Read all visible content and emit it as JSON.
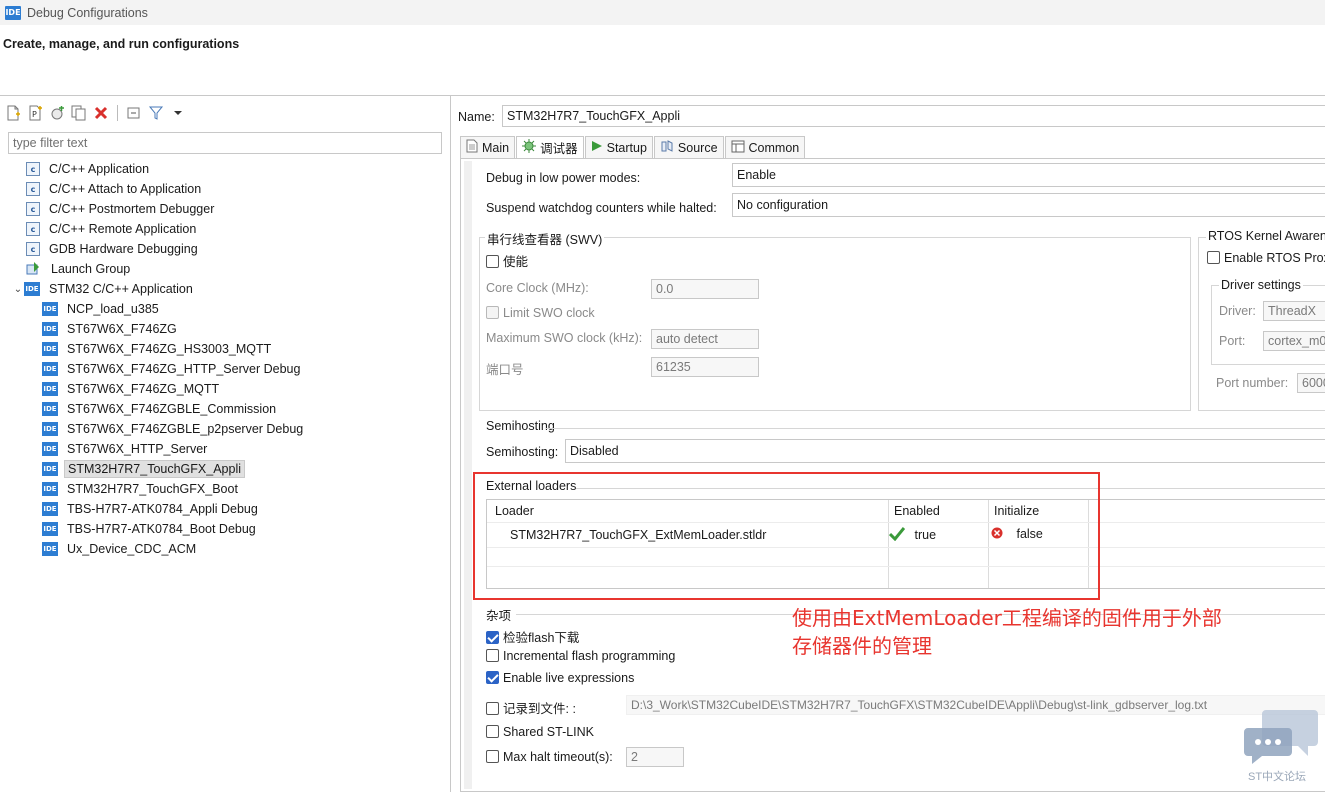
{
  "window": {
    "app_badge": "IDE",
    "title": "Debug Configurations"
  },
  "header": {
    "subtitle": "Create, manage, and run configurations"
  },
  "left": {
    "toolbar": [
      "new-config-icon",
      "new-prototype-icon",
      "export-icon",
      "duplicate-icon",
      "delete-icon",
      "collapse-all-icon",
      "filter-icon",
      "menu-chevron-icon"
    ],
    "filter_placeholder": "type filter text",
    "tree": [
      {
        "label": "C/C++ Application",
        "icon": "c"
      },
      {
        "label": "C/C++ Attach to Application",
        "icon": "c"
      },
      {
        "label": "C/C++ Postmortem Debugger",
        "icon": "c"
      },
      {
        "label": "C/C++ Remote Application",
        "icon": "c"
      },
      {
        "label": "GDB Hardware Debugging",
        "icon": "c"
      },
      {
        "label": "Launch Group",
        "icon": "launch"
      },
      {
        "label": "STM32 C/C++ Application",
        "icon": "ide",
        "expanded": true
      },
      {
        "label": "NCP_load_u385",
        "icon": "ide"
      },
      {
        "label": "ST67W6X_F746ZG",
        "icon": "ide"
      },
      {
        "label": "ST67W6X_F746ZG_HS3003_MQTT",
        "icon": "ide"
      },
      {
        "label": "ST67W6X_F746ZG_HTTP_Server Debug",
        "icon": "ide"
      },
      {
        "label": "ST67W6X_F746ZG_MQTT",
        "icon": "ide"
      },
      {
        "label": "ST67W6X_F746ZGBLE_Commission",
        "icon": "ide"
      },
      {
        "label": "ST67W6X_F746ZGBLE_p2pserver Debug",
        "icon": "ide"
      },
      {
        "label": "ST67W6X_HTTP_Server",
        "icon": "ide"
      },
      {
        "label": "STM32H7R7_TouchGFX_Appli",
        "icon": "ide",
        "selected": true
      },
      {
        "label": "STM32H7R7_TouchGFX_Boot",
        "icon": "ide"
      },
      {
        "label": "TBS-H7R7-ATK0784_Appli Debug",
        "icon": "ide"
      },
      {
        "label": "TBS-H7R7-ATK0784_Boot Debug",
        "icon": "ide"
      },
      {
        "label": "Ux_Device_CDC_ACM",
        "icon": "ide"
      }
    ]
  },
  "right": {
    "name_label": "Name:",
    "name_value": "STM32H7R7_TouchGFX_Appli",
    "tabs": [
      {
        "label": "Main",
        "icon": "main-tab-icon"
      },
      {
        "label": "调试器",
        "icon": "debugger-tab-icon",
        "active": true
      },
      {
        "label": "Startup",
        "icon": "startup-tab-icon"
      },
      {
        "label": "Source",
        "icon": "source-tab-icon"
      },
      {
        "label": "Common",
        "icon": "common-tab-icon"
      }
    ],
    "low_power_label": "Debug in low power modes:",
    "low_power_value": "Enable",
    "watchdog_label": "Suspend watchdog counters while halted:",
    "watchdog_value": "No configuration",
    "swv": {
      "title": "串行线查看器 (SWV)",
      "enable_label": "使能",
      "core_clock_label": "Core Clock (MHz):",
      "core_clock_value": "0.0",
      "limit_swo_label": "Limit SWO clock",
      "max_swo_label": "Maximum SWO clock (kHz):",
      "max_swo_value": "auto detect",
      "port_label": "端口号",
      "port_value": "61235"
    },
    "rtos": {
      "title": "RTOS Kernel Awaren",
      "enable_label": "Enable RTOS Prox",
      "driver_settings": "Driver settings",
      "driver_label": "Driver:",
      "driver_value": "ThreadX",
      "port_label": "Port:",
      "port_value": "cortex_m0",
      "port_number_label": "Port number:",
      "port_number_value": "6000"
    },
    "semihosting": {
      "title": "Semihosting",
      "label": "Semihosting:",
      "value": "Disabled"
    },
    "external_loaders": {
      "title": "External loaders",
      "columns": [
        "Loader",
        "Enabled",
        "Initialize"
      ],
      "rows": [
        {
          "loader": "STM32H7R7_TouchGFX_ExtMemLoader.stldr",
          "enabled": "true",
          "initialize": "false"
        }
      ]
    },
    "misc": {
      "title": "杂项",
      "verify_flash": "检验flash下载",
      "incremental": "Incremental flash programming",
      "live_expr": "Enable live expressions",
      "log_to_file": "记录到文件: :",
      "log_path": "D:\\3_Work\\STM32CubeIDE\\STM32H7R7_TouchGFX\\STM32CubeIDE\\Appli\\Debug\\st-link_gdbserver_log.txt",
      "shared_stlink": "Shared ST-LINK",
      "max_halt_label": "Max halt timeout(s):",
      "max_halt_value": "2"
    }
  },
  "annotation": {
    "line1": "使用由ExtMemLoader工程编译的固件用于外部",
    "line2": "存储器件的管理"
  },
  "watermark": {
    "text": "ST中文论坛"
  },
  "colors": {
    "accent": "#2d7dd2",
    "annotation_red": "#e8352f",
    "checkbox_blue": "#2b63c6"
  }
}
